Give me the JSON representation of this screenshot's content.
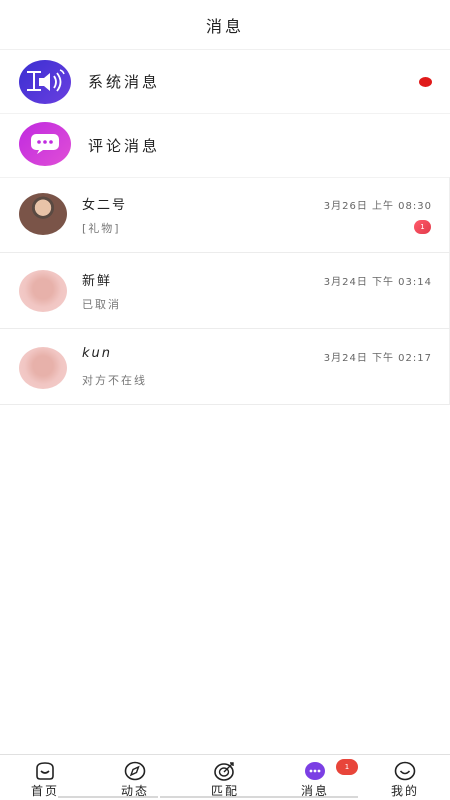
{
  "header": {
    "title": "消息"
  },
  "system_rows": [
    {
      "label": "系统消息",
      "unread_dot": true
    },
    {
      "label": "评论消息",
      "unread_dot": false
    }
  ],
  "chats": [
    {
      "name": "女二号",
      "time": "3月26日 上午 08:30",
      "preview": "[礼物]",
      "unread": "1",
      "avatar": "photo"
    },
    {
      "name": "新鲜",
      "time": "3月24日 下午 03:14",
      "preview": "已取消",
      "unread": "",
      "avatar": "blurred"
    },
    {
      "name": "kun",
      "time": "3月24日 下午 02:17",
      "preview": "对方不在线",
      "unread": "",
      "avatar": "blurred"
    }
  ],
  "tabbar": {
    "tabs": [
      {
        "label": "首页",
        "icon": "home-icon"
      },
      {
        "label": "动态",
        "icon": "compass-icon"
      },
      {
        "label": "匹配",
        "icon": "target-icon"
      },
      {
        "label": "消息",
        "icon": "chat-icon",
        "active": true
      },
      {
        "label": "我的",
        "icon": "smile-icon"
      }
    ],
    "message_badge": "1"
  },
  "colors": {
    "system_avatar": "#3b2fd1",
    "comment_avatar": "#c02ae0",
    "red_dot": "#e01a1a",
    "badge": "#e8453a",
    "active_tab_icon": "#7b3fe4"
  }
}
